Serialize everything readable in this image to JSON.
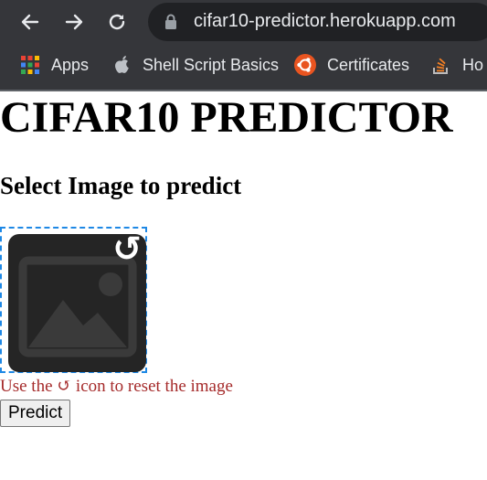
{
  "browser": {
    "url": "cifar10-predictor.herokuapp.com",
    "bookmarks": [
      {
        "label": "Apps",
        "icon": "apps-grid-icon"
      },
      {
        "label": "Shell Script Basics",
        "icon": "apple-icon"
      },
      {
        "label": "Certificates",
        "icon": "ubuntu-icon"
      },
      {
        "label": "Ho",
        "icon": "stackoverflow-icon"
      }
    ]
  },
  "page": {
    "title": "CIFAR10 PREDICTOR",
    "subtitle": "Select Image to predict",
    "hint": "Use the ↺ icon to reset the image",
    "reset_glyph": "↺",
    "predict_label": "Predict"
  },
  "colors": {
    "accent": "#1e88e5",
    "hint": "#a52a2a",
    "chrome_bg": "#35363a"
  }
}
